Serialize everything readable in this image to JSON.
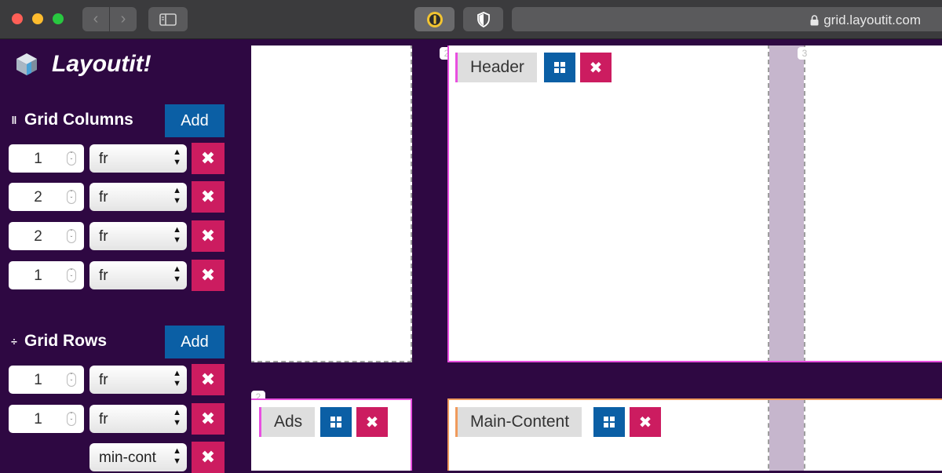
{
  "browser": {
    "url": "grid.layoutit.com",
    "lock_icon": "lock-icon"
  },
  "app": {
    "title": "Layoutit!",
    "logo_icon": "cube-icon"
  },
  "columns": {
    "title": "Grid Columns",
    "add_label": "Add",
    "rows": [
      {
        "value": "1",
        "unit": "fr"
      },
      {
        "value": "2",
        "unit": "fr"
      },
      {
        "value": "2",
        "unit": "fr"
      },
      {
        "value": "1",
        "unit": "fr"
      }
    ]
  },
  "rows": {
    "title": "Grid Rows",
    "add_label": "Add",
    "rows": [
      {
        "value": "1",
        "unit": "fr"
      },
      {
        "value": "1",
        "unit": "fr"
      },
      {
        "value": "",
        "unit": "min-cont"
      }
    ]
  },
  "canvas": {
    "line_numbers": [
      "2",
      "3",
      "2"
    ],
    "areas": [
      {
        "name": "Header",
        "color": "#e84fe0"
      },
      {
        "name": "Ads",
        "color": "#e84fe0"
      },
      {
        "name": "Main-Content",
        "color": "#f09a5c"
      }
    ]
  },
  "colors": {
    "background": "#2e0842",
    "add_button": "#0b5fa5",
    "delete_button": "#cc1c60",
    "area_header": "#e84fe0",
    "area_main": "#f09a5c",
    "gap_column": "#c6b6cd"
  }
}
